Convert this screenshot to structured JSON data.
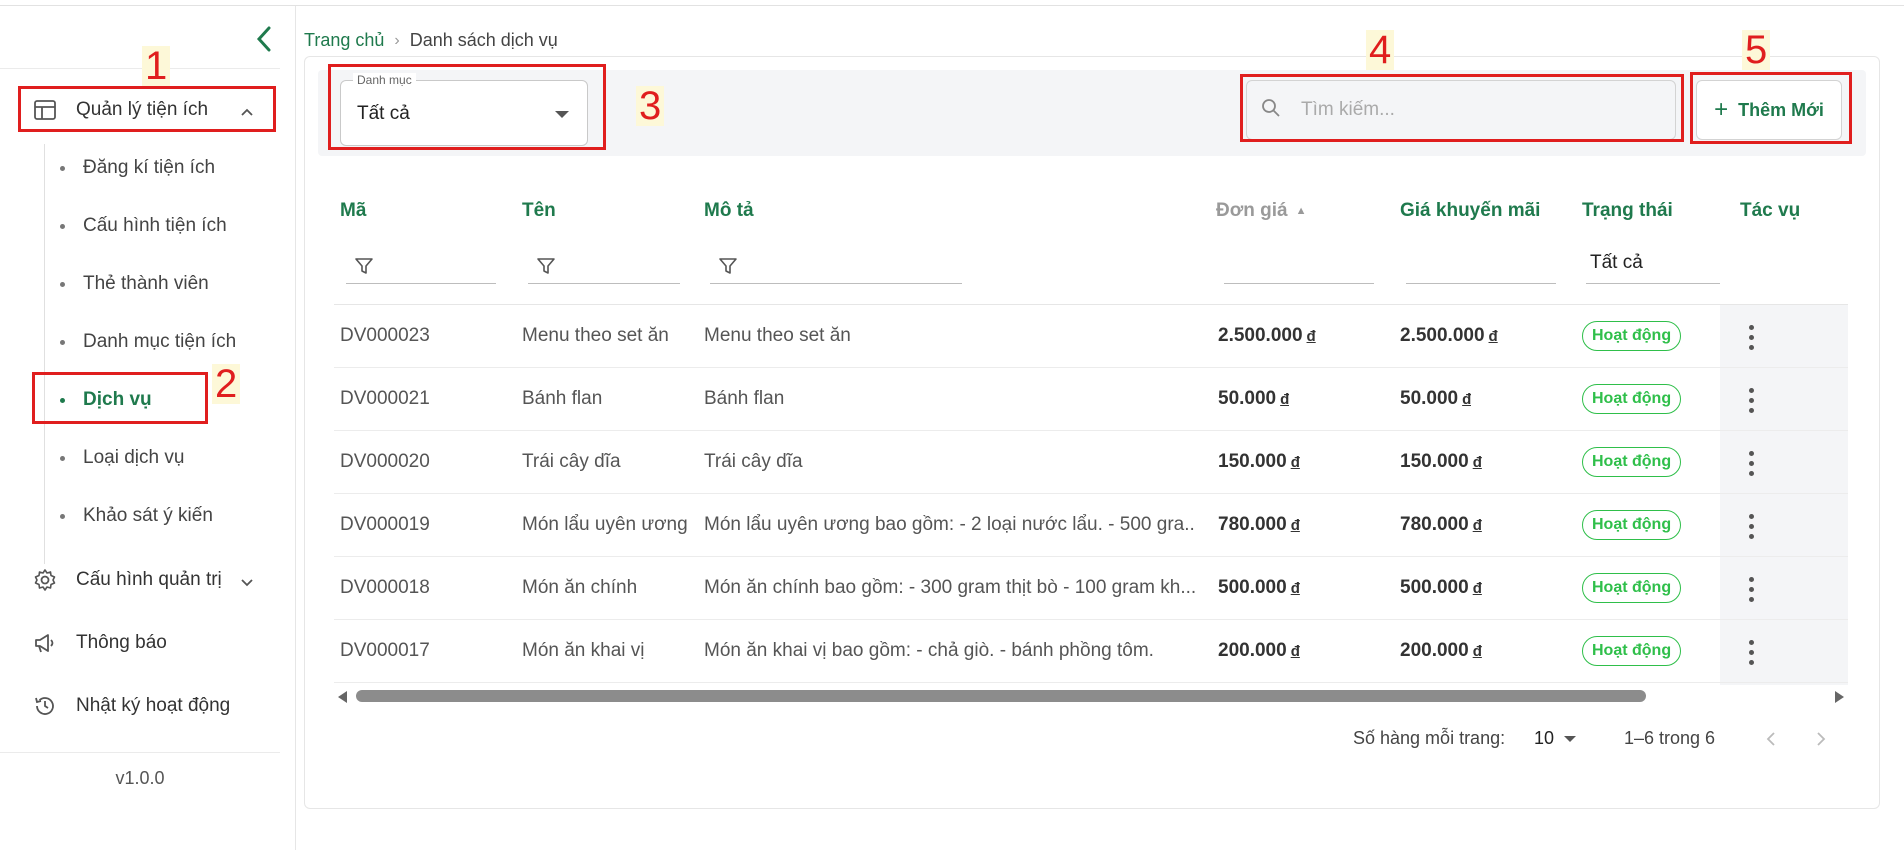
{
  "sidebar": {
    "groups": [
      {
        "label": "Quản lý tiện ích",
        "icon": "layout-table-icon"
      },
      {
        "label": "Cấu hình quản trị",
        "icon": "gear-icon"
      },
      {
        "label": "Thông báo",
        "icon": "megaphone-icon"
      },
      {
        "label": "Nhật ký hoạt động",
        "icon": "history-icon"
      }
    ],
    "sub_items": [
      {
        "label": "Đăng kí tiện ích"
      },
      {
        "label": "Cấu hình tiện ích"
      },
      {
        "label": "Thẻ thành viên"
      },
      {
        "label": "Danh mục tiện ích"
      },
      {
        "label": "Dịch vụ",
        "active": true
      },
      {
        "label": "Loại dịch vụ"
      },
      {
        "label": "Khảo sát ý kiến"
      }
    ],
    "version": "v1.0.0"
  },
  "breadcrumb": {
    "home": "Trang chủ",
    "separator": "›",
    "current": "Danh sách dịch vụ"
  },
  "toolbar": {
    "category_legend": "Danh mục",
    "category_value": "Tất cả",
    "search_placeholder": "Tìm kiếm...",
    "add_label": "Thêm Mới"
  },
  "annotations": [
    "1",
    "2",
    "3",
    "4",
    "5"
  ],
  "table": {
    "columns": [
      "Mã",
      "Tên",
      "Mô tả",
      "Đơn giá",
      "Giá khuyến mãi",
      "Trạng thái",
      "Tác vụ"
    ],
    "status_filter": "Tất cả",
    "currency": "đ",
    "rows": [
      {
        "code": "DV000023",
        "name": "Menu theo set ăn",
        "desc": "Menu theo set ăn",
        "price": "2.500.000",
        "promo": "2.500.000",
        "status": "Hoạt động"
      },
      {
        "code": "DV000021",
        "name": "Bánh flan",
        "desc": "Bánh flan",
        "price": "50.000",
        "promo": "50.000",
        "status": "Hoạt động"
      },
      {
        "code": "DV000020",
        "name": "Trái cây dĩa",
        "desc": "Trái cây dĩa",
        "price": "150.000",
        "promo": "150.000",
        "status": "Hoạt động"
      },
      {
        "code": "DV000019",
        "name": "Món lẩu uyên ương",
        "desc": "Món lẩu uyên ương bao gồm: - 2 loại nước lẩu. - 500 gra...",
        "price": "780.000",
        "promo": "780.000",
        "status": "Hoạt động"
      },
      {
        "code": "DV000018",
        "name": "Món ăn chính",
        "desc": "Món ăn chính bao gồm: - 300 gram thịt bò - 100 gram kh...",
        "price": "500.000",
        "promo": "500.000",
        "status": "Hoạt động"
      },
      {
        "code": "DV000017",
        "name": "Món ăn khai vị",
        "desc": "Món ăn khai vị bao gồm: - chả giò. - bánh phồng tôm.",
        "price": "200.000",
        "promo": "200.000",
        "status": "Hoạt động"
      }
    ]
  },
  "pagination": {
    "rows_per_page_label": "Số hàng mỗi trang:",
    "rows_per_page": "10",
    "range": "1–6 trong 6"
  }
}
